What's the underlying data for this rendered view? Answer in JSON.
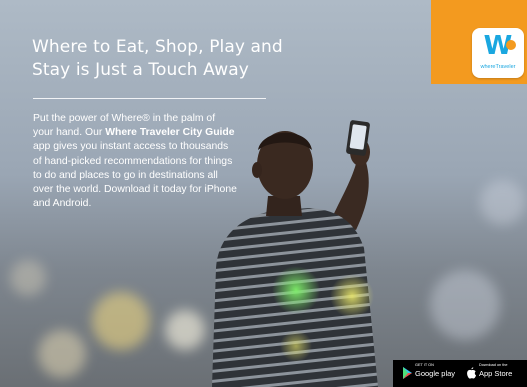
{
  "ad": {
    "headline": "Where to Eat, Shop, Play and Stay is Just a Touch Away",
    "body_part1": "Put the power of Where® in the palm of your hand. Our ",
    "body_bold": "Where Traveler City Guide",
    "body_part2": " app gives you instant access to thousands of hand-picked recommendations for things to do and places to go in destinations all over the world. Download it today for iPhone and Android."
  },
  "logo": {
    "mark": "W",
    "wordmark": "whereTraveler",
    "icon": "where-traveler-logo"
  },
  "stores": {
    "google_small": "GET IT ON",
    "google_big": "Google play",
    "google_icon": "google-play-icon",
    "apple_small": "Download on the",
    "apple_big": "App Store",
    "apple_icon": "apple-icon"
  },
  "colors": {
    "accent_orange": "#f39a1f",
    "logo_blue": "#1aa7e0",
    "text": "#ffffff"
  }
}
